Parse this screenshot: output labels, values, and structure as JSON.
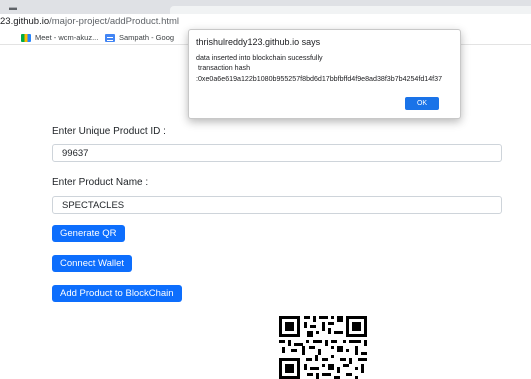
{
  "browser": {
    "url_host": "23.github.io",
    "url_path": "/major-project/addProduct.html",
    "bookmarks": [
      {
        "label": "Meet - wcm-akuz...",
        "icon": "meet-icon"
      },
      {
        "label": "Sampath - Goog",
        "icon": "doc-icon"
      }
    ]
  },
  "dialog": {
    "title": "thrishulreddy123.github.io says",
    "message": "data inserted into blockchain sucessfully\n transaction hash\n:0xe0a6e619a122b1080b955257f8bd6d17bbfbffd4f9e8ad38f3b7b4254fd14f37",
    "ok_label": "OK"
  },
  "form": {
    "product_id_label": "Enter Unique Product ID :",
    "product_id_value": "99637",
    "product_name_label": "Enter Product Name :",
    "product_name_value": "SPECTACLES"
  },
  "buttons": {
    "generate_qr": "Generate QR",
    "connect_wallet": "Connect Wallet",
    "add_product": "Add Product to BlockChain"
  },
  "colors": {
    "primary_button": "#0d6efd",
    "dialog_ok": "#1a73e8"
  }
}
